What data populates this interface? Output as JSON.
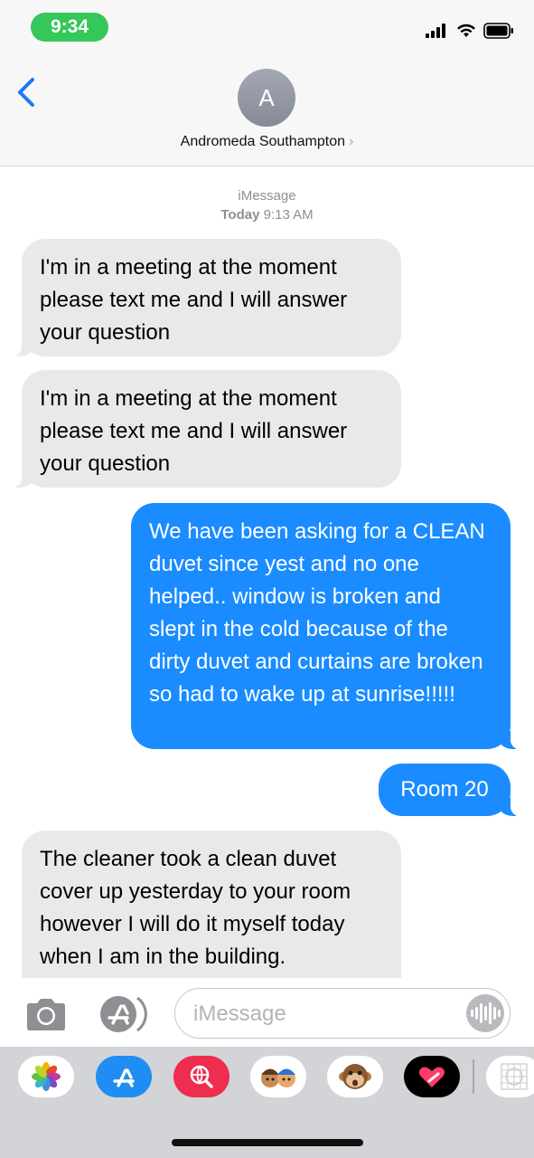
{
  "status_bar": {
    "time": "9:34"
  },
  "header": {
    "avatar_letter": "A",
    "contact_name": "Andromeda Southampton",
    "chevron": "›"
  },
  "conversation": {
    "service": "iMessage",
    "day": "Today",
    "time": "9:13 AM",
    "messages": [
      {
        "direction": "incoming",
        "text": "I'm in a meeting at the moment please text me and I will answer your question"
      },
      {
        "direction": "incoming",
        "text": "I'm in a meeting at the moment please text me and I will answer your question"
      },
      {
        "direction": "outgoing",
        "text": "We have been asking for a CLEAN duvet since yest and no one helped.. window is broken and slept in the cold because of the dirty duvet and curtains are broken so had to wake up at sunrise!!!!!"
      },
      {
        "direction": "outgoing",
        "text": "Room 20"
      },
      {
        "direction": "incoming",
        "text": "The cleaner took a clean duvet cover up yesterday to your room however I will do it myself today when I am in the building."
      }
    ]
  },
  "input_bar": {
    "placeholder": "iMessage"
  },
  "app_drawer": {
    "apps": [
      "photos-app-icon",
      "app-store-icon",
      "images-search-icon",
      "memoji-stickers-icon",
      "animoji-monkey-icon",
      "digital-touch-icon",
      "more-apps-icon"
    ]
  },
  "colors": {
    "outgoing_bubble": "#1a8cff",
    "incoming_bubble": "#e9e9eb",
    "time_pill": "#35c759"
  }
}
